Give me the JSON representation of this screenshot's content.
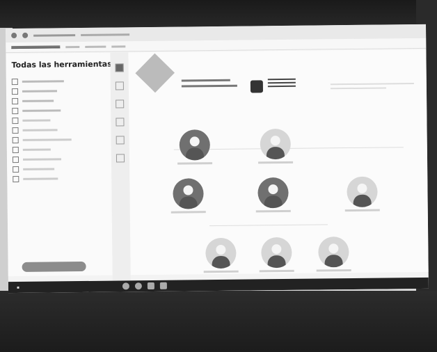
{
  "sidebar": {
    "title": "Todas las herramientas"
  }
}
